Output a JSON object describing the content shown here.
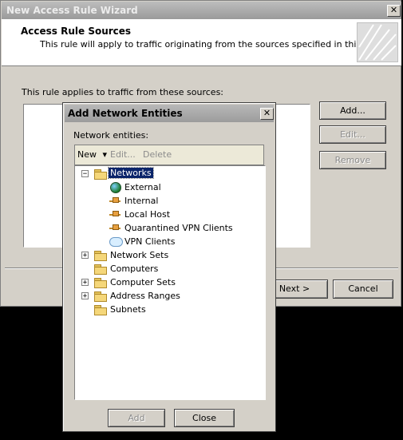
{
  "wizard": {
    "title": "New Access Rule Wizard",
    "close_glyph": "✕",
    "header_title": "Access Rule Sources",
    "header_subtitle": "This rule will apply to traffic originating from the sources specified in this page.",
    "sources_label": "This rule applies to traffic from these sources:",
    "buttons": {
      "add": "Add...",
      "edit": "Edit...",
      "remove": "Remove",
      "next": "Next >",
      "cancel": "Cancel"
    }
  },
  "dialog": {
    "title": "Add Network Entities",
    "close_glyph": "✕",
    "entities_label": "Network entities:",
    "toolbar": {
      "new": "New",
      "edit": "Edit...",
      "delete": "Delete"
    },
    "tree": {
      "networks": "Networks",
      "children": [
        "External",
        "Internal",
        "Local Host",
        "Quarantined VPN Clients",
        "VPN Clients"
      ],
      "network_sets": "Network Sets",
      "computers": "Computers",
      "computer_sets": "Computer Sets",
      "address_ranges": "Address Ranges",
      "subnets": "Subnets"
    },
    "buttons": {
      "add": "Add",
      "close": "Close"
    }
  },
  "icons": {
    "expand": "+",
    "collapse": "−",
    "dropdown": "▾"
  },
  "colors": {
    "selection": "#0a246a",
    "window_bg": "#d4d0c8"
  }
}
